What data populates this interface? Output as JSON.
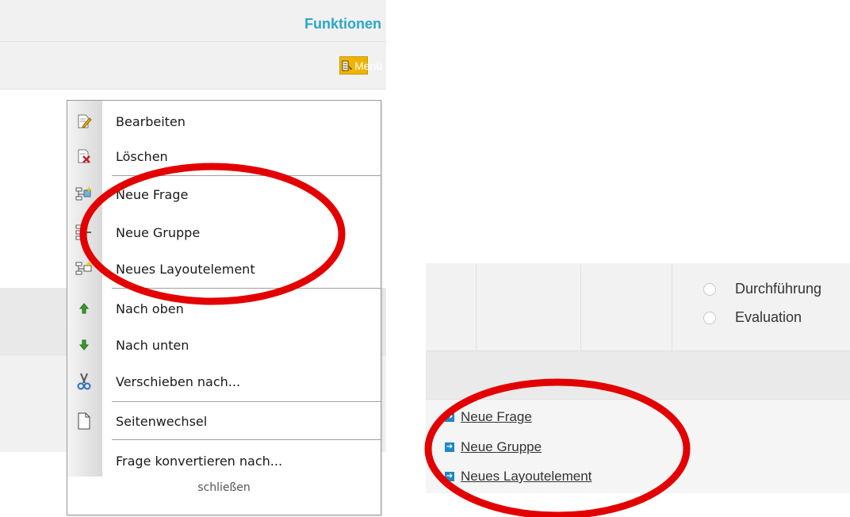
{
  "header": {
    "functions_label": "Funktionen",
    "menu_button_label": "Menü"
  },
  "context_menu": {
    "items": [
      {
        "label": "Bearbeiten",
        "icon": "edit-icon"
      },
      {
        "label": "Löschen",
        "icon": "delete-icon"
      },
      {
        "label": "Neue Frage",
        "icon": "new-question-icon"
      },
      {
        "label": "Neue Gruppe",
        "icon": "new-group-icon"
      },
      {
        "label": "Neues Layoutelement",
        "icon": "new-layout-element-icon"
      },
      {
        "label": "Nach oben",
        "icon": "arrow-up-icon"
      },
      {
        "label": "Nach unten",
        "icon": "arrow-down-icon"
      },
      {
        "label": "Verschieben nach...",
        "icon": "scissors-icon"
      },
      {
        "label": "Seitenwechsel",
        "icon": "page-icon"
      },
      {
        "label": "Frage konvertieren nach...",
        "icon": ""
      }
    ],
    "close_label": "schließen"
  },
  "right_panel": {
    "radio_options": [
      {
        "label": "Durchführung"
      },
      {
        "label": "Evaluation"
      }
    ],
    "links": [
      {
        "label": "Neue Frage"
      },
      {
        "label": "Neue Gruppe"
      },
      {
        "label": "Neues Layoutelement"
      }
    ]
  },
  "colors": {
    "accent_blue": "#2aa7c9",
    "menu_button": "#f0b400",
    "annotation_red": "#e30000"
  }
}
